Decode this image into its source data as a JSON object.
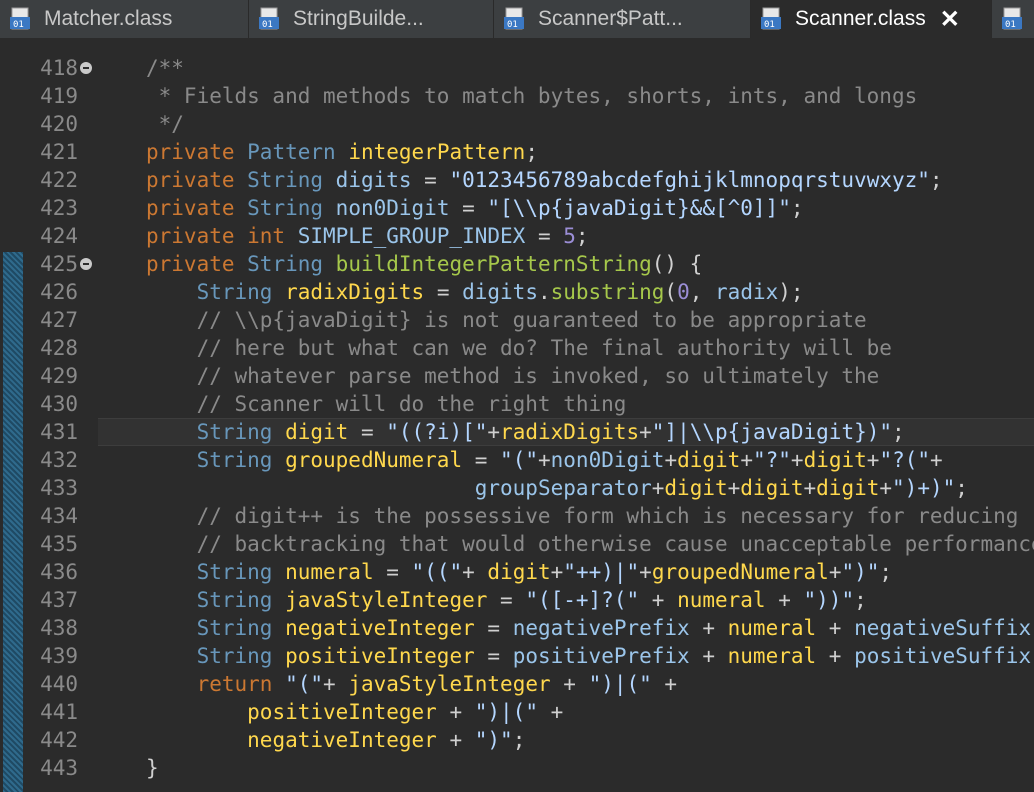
{
  "tabs": [
    {
      "label": "Matcher.class",
      "icon": "class-file-icon",
      "active": false
    },
    {
      "label": "StringBuilde...",
      "icon": "class-file-icon",
      "active": false
    },
    {
      "label": "Scanner$Patt...",
      "icon": "class-file-icon",
      "active": false
    },
    {
      "label": "Scanner.class",
      "icon": "class-file-icon",
      "active": true
    }
  ],
  "editor": {
    "lines": [
      {
        "num": "418",
        "fold": true,
        "tokens": [
          [
            "c",
            "/**"
          ]
        ]
      },
      {
        "num": "419",
        "tokens": [
          [
            "c",
            " * Fields and methods to match bytes, shorts, ints, and longs"
          ]
        ]
      },
      {
        "num": "420",
        "tokens": [
          [
            "c",
            " */"
          ]
        ]
      },
      {
        "num": "421",
        "tokens": [
          [
            "k",
            "private "
          ],
          [
            "t",
            "Pattern "
          ],
          [
            "v",
            "integerPattern"
          ],
          [
            "p",
            ";"
          ]
        ]
      },
      {
        "num": "422",
        "tokens": [
          [
            "k",
            "private "
          ],
          [
            "t",
            "String "
          ],
          [
            "f",
            "digits"
          ],
          [
            "p",
            " = "
          ],
          [
            "s",
            "\"0123456789abcdefghijklmnopqrstuvwxyz\""
          ],
          [
            "p",
            ";"
          ]
        ]
      },
      {
        "num": "423",
        "tokens": [
          [
            "k",
            "private "
          ],
          [
            "t",
            "String "
          ],
          [
            "f",
            "non0Digit"
          ],
          [
            "p",
            " = "
          ],
          [
            "s",
            "\"[\\\\p{javaDigit}&&[^0]]\""
          ],
          [
            "p",
            ";"
          ]
        ]
      },
      {
        "num": "424",
        "tokens": [
          [
            "k",
            "private int "
          ],
          [
            "f",
            "SIMPLE_GROUP_INDEX"
          ],
          [
            "p",
            " = "
          ],
          [
            "n",
            "5"
          ],
          [
            "p",
            ";"
          ]
        ]
      },
      {
        "num": "425",
        "fold": true,
        "tokens": [
          [
            "k",
            "private "
          ],
          [
            "t",
            "String "
          ],
          [
            "m",
            "buildIntegerPatternString"
          ],
          [
            "p",
            "() {"
          ]
        ]
      },
      {
        "num": "426",
        "tokens": [
          [
            "p",
            "    "
          ],
          [
            "t",
            "String "
          ],
          [
            "v",
            "radixDigits"
          ],
          [
            "p",
            " = "
          ],
          [
            "f",
            "digits"
          ],
          [
            "p",
            "."
          ],
          [
            "m",
            "substring"
          ],
          [
            "p",
            "("
          ],
          [
            "n",
            "0"
          ],
          [
            "p",
            ", "
          ],
          [
            "f",
            "radix"
          ],
          [
            "p",
            ");"
          ]
        ]
      },
      {
        "num": "427",
        "tokens": [
          [
            "c",
            "    // \\\\p{javaDigit} is not guaranteed to be appropriate"
          ]
        ]
      },
      {
        "num": "428",
        "tokens": [
          [
            "c",
            "    // here but what can we do? The final authority will be"
          ]
        ]
      },
      {
        "num": "429",
        "tokens": [
          [
            "c",
            "    // whatever parse method is invoked, so ultimately the"
          ]
        ]
      },
      {
        "num": "430",
        "tokens": [
          [
            "c",
            "    // Scanner will do the right thing"
          ]
        ]
      },
      {
        "num": "431",
        "current": true,
        "tokens": [
          [
            "p",
            "    "
          ],
          [
            "t",
            "String "
          ],
          [
            "v",
            "digit"
          ],
          [
            "p",
            " = "
          ],
          [
            "s",
            "\"((?i)[\""
          ],
          [
            "p",
            "+"
          ],
          [
            "v",
            "radixDigits"
          ],
          [
            "p",
            "+"
          ],
          [
            "s",
            "\"]|\\\\p{javaDigit})\""
          ],
          [
            "p",
            ";"
          ]
        ]
      },
      {
        "num": "432",
        "tokens": [
          [
            "p",
            "    "
          ],
          [
            "t",
            "String "
          ],
          [
            "v",
            "groupedNumeral"
          ],
          [
            "p",
            " = "
          ],
          [
            "s",
            "\"(\""
          ],
          [
            "p",
            "+"
          ],
          [
            "f",
            "non0Digit"
          ],
          [
            "p",
            "+"
          ],
          [
            "v",
            "digit"
          ],
          [
            "p",
            "+"
          ],
          [
            "s",
            "\"?\""
          ],
          [
            "p",
            "+"
          ],
          [
            "v",
            "digit"
          ],
          [
            "p",
            "+"
          ],
          [
            "s",
            "\"?(\""
          ],
          [
            "p",
            "+"
          ]
        ]
      },
      {
        "num": "433",
        "tokens": [
          [
            "p",
            "                          "
          ],
          [
            "f",
            "groupSeparator"
          ],
          [
            "p",
            "+"
          ],
          [
            "v",
            "digit"
          ],
          [
            "p",
            "+"
          ],
          [
            "v",
            "digit"
          ],
          [
            "p",
            "+"
          ],
          [
            "v",
            "digit"
          ],
          [
            "p",
            "+"
          ],
          [
            "s",
            "\")+)\""
          ],
          [
            "p",
            ";"
          ]
        ]
      },
      {
        "num": "434",
        "tokens": [
          [
            "c",
            "    // digit++ is the possessive form which is necessary for reducing"
          ]
        ]
      },
      {
        "num": "435",
        "tokens": [
          [
            "c",
            "    // backtracking that would otherwise cause unacceptable performance"
          ]
        ]
      },
      {
        "num": "436",
        "tokens": [
          [
            "p",
            "    "
          ],
          [
            "t",
            "String "
          ],
          [
            "v",
            "numeral"
          ],
          [
            "p",
            " = "
          ],
          [
            "s",
            "\"((\""
          ],
          [
            "p",
            "+ "
          ],
          [
            "v",
            "digit"
          ],
          [
            "p",
            "+"
          ],
          [
            "s",
            "\"++)|\""
          ],
          [
            "p",
            "+"
          ],
          [
            "v",
            "groupedNumeral"
          ],
          [
            "p",
            "+"
          ],
          [
            "s",
            "\")\""
          ],
          [
            "p",
            ";"
          ]
        ]
      },
      {
        "num": "437",
        "tokens": [
          [
            "p",
            "    "
          ],
          [
            "t",
            "String "
          ],
          [
            "v",
            "javaStyleInteger"
          ],
          [
            "p",
            " = "
          ],
          [
            "s",
            "\"([-+]?(\""
          ],
          [
            "p",
            " + "
          ],
          [
            "v",
            "numeral"
          ],
          [
            "p",
            " + "
          ],
          [
            "s",
            "\"))\""
          ],
          [
            "p",
            ";"
          ]
        ]
      },
      {
        "num": "438",
        "tokens": [
          [
            "p",
            "    "
          ],
          [
            "t",
            "String "
          ],
          [
            "v",
            "negativeInteger"
          ],
          [
            "p",
            " = "
          ],
          [
            "f",
            "negativePrefix"
          ],
          [
            "p",
            " + "
          ],
          [
            "v",
            "numeral"
          ],
          [
            "p",
            " + "
          ],
          [
            "f",
            "negativeSuffix"
          ],
          [
            "p",
            ";"
          ]
        ]
      },
      {
        "num": "439",
        "tokens": [
          [
            "p",
            "    "
          ],
          [
            "t",
            "String "
          ],
          [
            "v",
            "positiveInteger"
          ],
          [
            "p",
            " = "
          ],
          [
            "f",
            "positivePrefix"
          ],
          [
            "p",
            " + "
          ],
          [
            "v",
            "numeral"
          ],
          [
            "p",
            " + "
          ],
          [
            "f",
            "positiveSuffix"
          ],
          [
            "p",
            ";"
          ]
        ]
      },
      {
        "num": "440",
        "tokens": [
          [
            "p",
            "    "
          ],
          [
            "k",
            "return "
          ],
          [
            "s",
            "\"(\""
          ],
          [
            "p",
            "+ "
          ],
          [
            "v",
            "javaStyleInteger"
          ],
          [
            "p",
            " + "
          ],
          [
            "s",
            "\")|(\""
          ],
          [
            "p",
            " +"
          ]
        ]
      },
      {
        "num": "441",
        "tokens": [
          [
            "p",
            "        "
          ],
          [
            "v",
            "positiveInteger"
          ],
          [
            "p",
            " + "
          ],
          [
            "s",
            "\")|(\""
          ],
          [
            "p",
            " +"
          ]
        ]
      },
      {
        "num": "442",
        "tokens": [
          [
            "p",
            "        "
          ],
          [
            "v",
            "negativeInteger"
          ],
          [
            "p",
            " + "
          ],
          [
            "s",
            "\")\""
          ],
          [
            "p",
            ";"
          ]
        ]
      },
      {
        "num": "443",
        "tokens": [
          [
            "p",
            "}"
          ]
        ]
      }
    ]
  },
  "colors": {
    "background": "#2b2b2b",
    "keyword": "#cc7832",
    "type": "#6897bb",
    "string": "#b4d6ff",
    "comment": "#8a8a8a",
    "local": "#ffd84d",
    "field": "#9bc5ea",
    "method": "#a6c84b"
  }
}
